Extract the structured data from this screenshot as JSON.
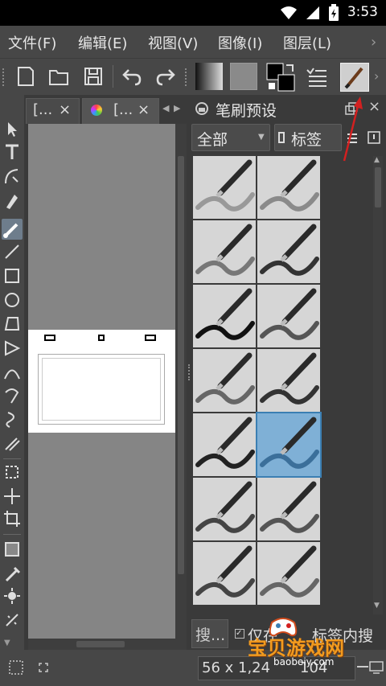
{
  "status_bar": {
    "time": "3:53"
  },
  "menu": {
    "items": [
      "文件(F)",
      "编辑(E)",
      "视图(V)",
      "图像(I)",
      "图层(L)"
    ]
  },
  "toolbar": {
    "icons": [
      "new-document-icon",
      "open-folder-icon",
      "save-icon",
      "undo-icon",
      "redo-icon",
      "gradient-swatch",
      "pattern-swatch",
      "fg-bg-color-icon",
      "layer-list-icon",
      "brush-preset-icon"
    ]
  },
  "doc_tabs": [
    {
      "label": "[...",
      "close": "×"
    },
    {
      "label": "[...",
      "close": "×"
    }
  ],
  "docker": {
    "title": "笔刷预设",
    "filter_all": "全部",
    "tag_label": "标签",
    "search_placeholder": "搜...",
    "only_search_label": "仅在",
    "tag_search_label": "标签内搜"
  },
  "brush_presets": [
    {
      "name": "eraser-block",
      "selected": false
    },
    {
      "name": "eraser-pen",
      "selected": false
    },
    {
      "name": "soft-eraser",
      "selected": false
    },
    {
      "name": "airbrush",
      "selected": false
    },
    {
      "name": "ink-pen-black",
      "selected": false
    },
    {
      "name": "ink-pen-soft",
      "selected": false
    },
    {
      "name": "marker-gray",
      "selected": false
    },
    {
      "name": "marker-dark",
      "selected": false
    },
    {
      "name": "brush-flat",
      "selected": false
    },
    {
      "name": "brush-watercolor",
      "selected": true
    },
    {
      "name": "brush-orange",
      "selected": false
    },
    {
      "name": "pencil-blue",
      "selected": false
    },
    {
      "name": "pencil-sketch",
      "selected": false
    },
    {
      "name": "pencil-light",
      "selected": false
    }
  ],
  "status_line": {
    "coords": "56 x 1,24",
    "extra": "104"
  },
  "watermark": {
    "text": "宝贝游戏网",
    "url": "baobeiy.com"
  },
  "colors": {
    "chrome": "#474747",
    "canvas_bg": "#858585",
    "accent": "#3b7fb3",
    "arrow": "#d32020"
  }
}
